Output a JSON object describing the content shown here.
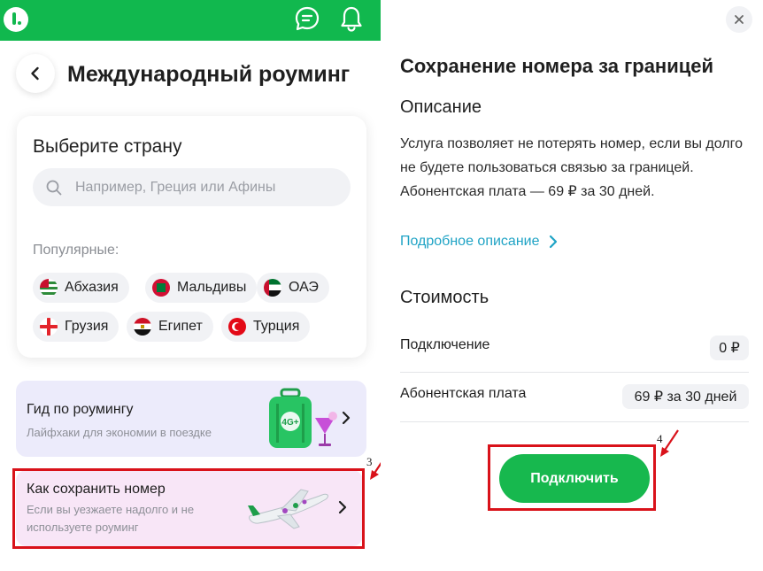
{
  "left": {
    "page_title": "Международный роуминг",
    "country_card": {
      "title": "Выберите страну",
      "search_placeholder": "Например, Греция или Афины",
      "popular_label": "Популярные:",
      "chips": [
        {
          "label": "Абхазия",
          "flag": "abkhazia-flag-icon"
        },
        {
          "label": "Мальдивы",
          "flag": "maldives-flag-icon"
        },
        {
          "label": "ОАЭ",
          "flag": "uae-flag-icon"
        },
        {
          "label": "Грузия",
          "flag": "georgia-flag-icon"
        },
        {
          "label": "Египет",
          "flag": "egypt-flag-icon"
        },
        {
          "label": "Турция",
          "flag": "turkey-flag-icon"
        }
      ]
    },
    "guide_card": {
      "title": "Гид по роумингу",
      "subtitle": "Лайфхаки для экономии в поездке",
      "badge": "4G+"
    },
    "howto_card": {
      "title": "Как сохранить номер",
      "subtitle": "Если вы уезжаете надолго и не используете роуминг"
    },
    "annotation_number": "3"
  },
  "right": {
    "title": "Сохранение номера за границей",
    "description_heading": "Описание",
    "description": "Услуга позволяет не потерять номер, если вы долго не будете пользоваться связью за границей. Абонентская плата — 69 ₽ за 30 дней.",
    "more_link": "Подробное описание",
    "cost_heading": "Стоимость",
    "rows": [
      {
        "label": "Подключение",
        "value": "0 ₽"
      },
      {
        "label": "Абонентская плата",
        "value": "69 ₽ за 30 дней"
      }
    ],
    "connect_button": "Подключить",
    "annotation_number": "4"
  },
  "colors": {
    "brand_green": "#11b84e",
    "link_blue": "#1fa3c5",
    "annotation_red": "#d9121a",
    "guide_bg": "#ecebfb",
    "howto_bg": "#f8e6f7"
  }
}
